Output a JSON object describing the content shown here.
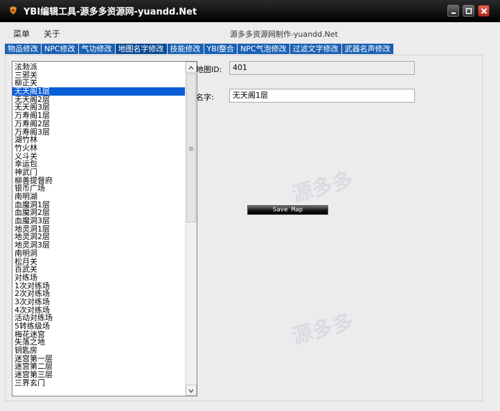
{
  "window": {
    "title": "YBI编辑工具-源多多资源网-yuandd.Net"
  },
  "menu": {
    "items": [
      "菜单",
      "关于"
    ],
    "credit": "源多多资源网制作-yuandd.Net"
  },
  "tabs": [
    "物品修改",
    "NPC修改",
    "气功修改",
    "地图名字修改",
    "技能修改",
    "YBI整合",
    "NPC气泡修改",
    "过滤文字修改",
    "武器名声修改"
  ],
  "active_tab": "地图名字修改",
  "map_list": {
    "selected": "无天阁1层",
    "items": [
      "泫勃派",
      "三邪关",
      "柳正关",
      "无天阁1层",
      "无天阁2层",
      "无天阁3层",
      "万寿阁1层",
      "万寿阁2层",
      "万寿阁3层",
      "湖竹林",
      "竹火林",
      "义斗关",
      "幸运包",
      "神武门",
      "柳善提督府",
      "银币广场",
      "南明湖",
      "血魔洞1层",
      "血魔洞2层",
      "血魔洞3层",
      "地灵洞1层",
      "地灵洞2层",
      "地灵洞3层",
      "南明洞",
      "松月关",
      "百武关",
      "对练场",
      "1次对练场",
      "2次对练场",
      "3次对练场",
      "4次对练场",
      "活动对练场",
      "5转练级场",
      "梅花迷宫",
      "失落之地",
      "钥匙房",
      "迷宫第一层",
      "迷宫第二层",
      "迷宫第三层",
      "三界玄门"
    ]
  },
  "form": {
    "map_id_label": "地图ID:",
    "map_id_value": "401",
    "name_label": "名字:",
    "name_value": "无天阁1层",
    "save_button": "Save Map"
  },
  "watermark": {
    "text": "源多多"
  }
}
